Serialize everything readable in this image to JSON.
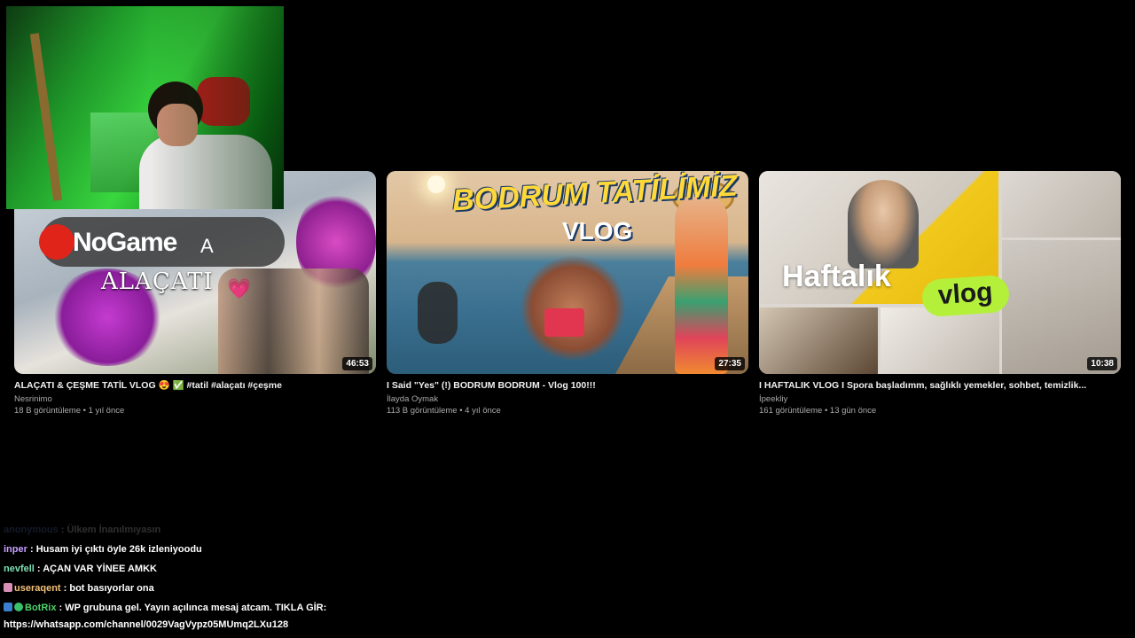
{
  "videos": [
    {
      "title": "ALAÇATI & ÇEŞME TATİL VLOG 😍 ✅ #tatil #alaçatı #çeşme",
      "channel": "Nesrinimo",
      "meta": "18 B görüntüleme • 1 yıl önce",
      "duration": "46:53",
      "thumb_logo": "NoGame",
      "thumb_caption": "ALAÇATI",
      "thumb_letter": "A",
      "thumb_heart": "💗"
    },
    {
      "title": "I Said \"Yes\" (!) BODRUM BODRUM - Vlog 100!!!",
      "channel": "İlayda Oymak",
      "meta": "113 B görüntüleme • 4 yıl önce",
      "duration": "27:35",
      "thumb_line1": "BODRUM TATİLİMİZ",
      "thumb_line2": "VLOG"
    },
    {
      "title": "I HAFTALIK VLOG I Spora başladımm, sağlıklı yemekler, sohbet, temizlik...",
      "channel": "İpeekliy",
      "meta": "161 görüntüleme • 13 gün önce",
      "duration": "10:38",
      "thumb_line1": "Haftalık",
      "thumb_line2": "vlog"
    }
  ],
  "chat": [
    {
      "user": "anonymous",
      "user_color": "#6b8bd6",
      "text": "Ülkem İnanılmıyasın",
      "faded": true,
      "badges": []
    },
    {
      "user": "inper",
      "user_color": "#c9a0ff",
      "text": "Husam iyi çıktı öyle 26k izleniyoodu",
      "faded": false,
      "badges": []
    },
    {
      "user": "nevfell",
      "user_color": "#7ee0b5",
      "text": "AÇAN VAR YİNEE AMKK",
      "faded": false,
      "badges": []
    },
    {
      "user": "useraqent",
      "user_color": "#f2c27a",
      "text": "bot basıyorlar ona",
      "faded": false,
      "badges": [
        "pink"
      ]
    },
    {
      "user": "BotRix",
      "user_color": "#4fd36b",
      "text": "WP grubuna gel. Yayın açılınca mesaj atcam. TIKLA GİR:",
      "faded": false,
      "badges": [
        "blue",
        "green"
      ]
    },
    {
      "user": "",
      "user_color": "#ffffff",
      "text": "https://whatsapp.com/channel/0029VagVypz05MUmq2LXu128",
      "faded": false,
      "badges": []
    }
  ]
}
